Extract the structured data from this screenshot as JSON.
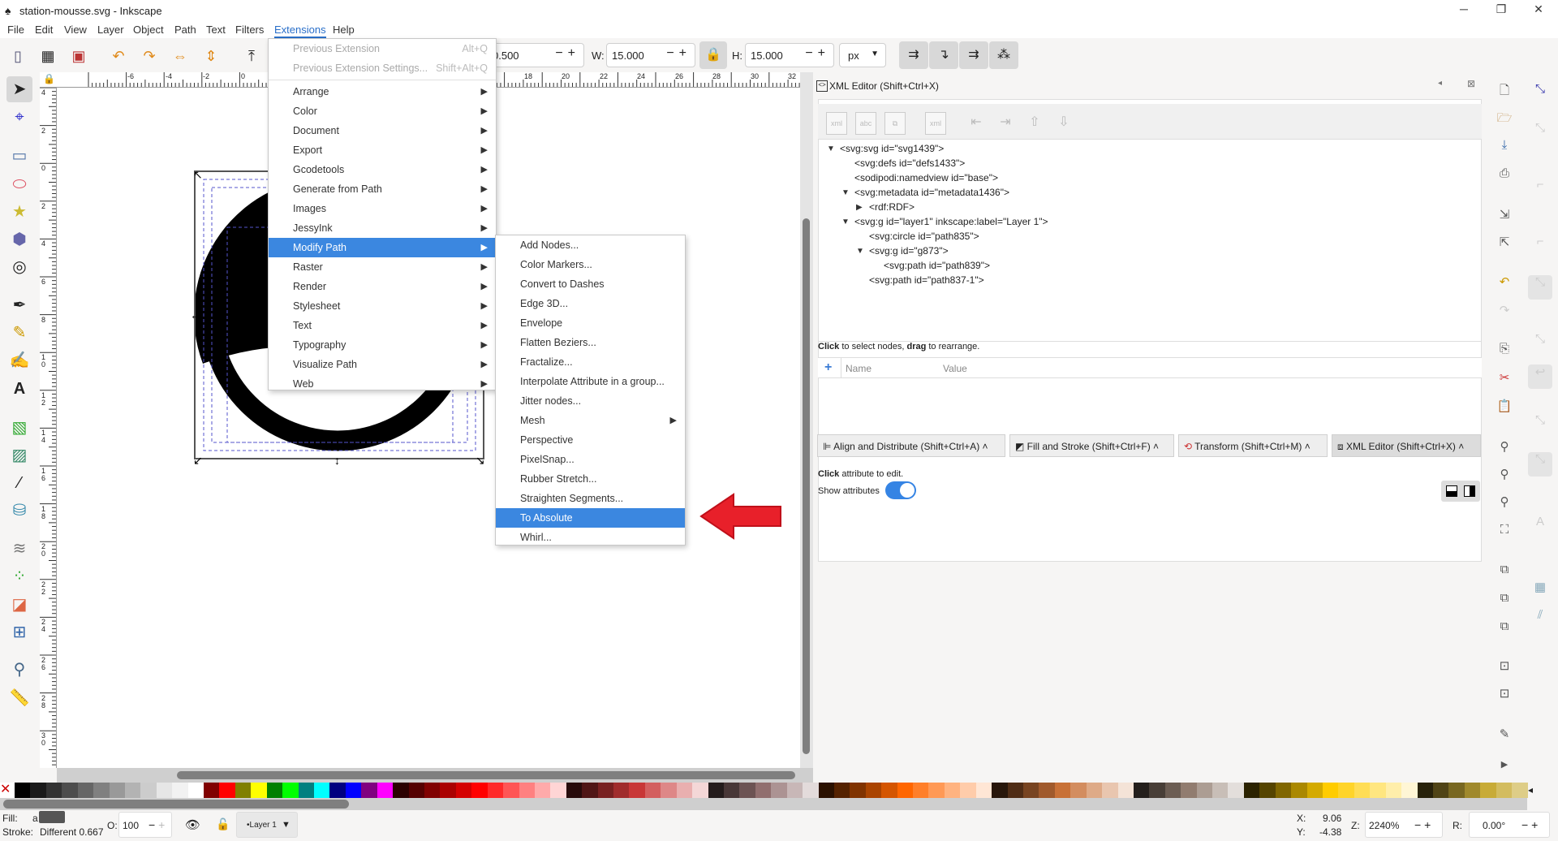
{
  "window": {
    "title": "station-mousse.svg - Inkscape",
    "minimize": "─",
    "maximize": "❐",
    "close": "✕"
  },
  "menubar": [
    "File",
    "Edit",
    "View",
    "Layer",
    "Object",
    "Path",
    "Text",
    "Filters",
    "Extensions",
    "Help"
  ],
  "toolbar": {
    "x_value": "0.500",
    "w_label": "W:",
    "w_value": "15.000",
    "h_label": "H:",
    "h_value": "15.000",
    "unit": "px",
    "minus": "−",
    "plus": "+"
  },
  "ruler": {
    "h_ticks": [
      "-6",
      "-4",
      "-2",
      "0",
      "2",
      "18",
      "20",
      "22",
      "24",
      "26",
      "28",
      "30",
      "32"
    ],
    "v_ticks": [
      "4",
      "2",
      "0",
      "2",
      "4",
      "6",
      "8",
      "10",
      "12",
      "14",
      "16",
      "18",
      "20",
      "22",
      "24",
      "26",
      "28",
      "30"
    ]
  },
  "extensions_menu": {
    "previous": {
      "label": "Previous Extension",
      "shortcut": "Alt+Q"
    },
    "previous_settings": {
      "label": "Previous Extension Settings...",
      "shortcut": "Shift+Alt+Q"
    },
    "items": [
      "Arrange",
      "Color",
      "Document",
      "Export",
      "Gcodetools",
      "Generate from Path",
      "Images",
      "JessyInk",
      "Modify Path",
      "Raster",
      "Render",
      "Stylesheet",
      "Text",
      "Typography",
      "Visualize Path",
      "Web"
    ],
    "highlighted": "Modify Path"
  },
  "modify_path_menu": {
    "items": [
      "Add Nodes...",
      "Color Markers...",
      "Convert to Dashes",
      "Edge 3D...",
      "Envelope",
      "Flatten Beziers...",
      "Fractalize...",
      "Interpolate Attribute in a group...",
      "Jitter nodes...",
      "Mesh",
      "Perspective",
      "PixelSnap...",
      "Rubber Stretch...",
      "Straighten Segments...",
      "To Absolute",
      "Whirl..."
    ],
    "highlighted": "To Absolute",
    "submenu_item": "Mesh"
  },
  "annotation": {
    "arrow_color": "#e8202a"
  },
  "xml_editor": {
    "title": "XML Editor (Shift+Ctrl+X)",
    "nodes": [
      {
        "text": "<svg:svg id=\"svg1439\">",
        "level": 0,
        "expander": "expanded"
      },
      {
        "text": "<svg:defs id=\"defs1433\">",
        "level": 1,
        "expander": "none"
      },
      {
        "text": "<sodipodi:namedview id=\"base\">",
        "level": 1,
        "expander": "none"
      },
      {
        "text": "<svg:metadata id=\"metadata1436\">",
        "level": 1,
        "expander": "expanded"
      },
      {
        "text": "<rdf:RDF>",
        "level": 2,
        "expander": "collapsed"
      },
      {
        "text": "<svg:g id=\"layer1\" inkscape:label=\"Layer 1\">",
        "level": 1,
        "expander": "expanded"
      },
      {
        "text": "<svg:circle id=\"path835\">",
        "level": 2,
        "expander": "none"
      },
      {
        "text": "<svg:g id=\"g873\">",
        "level": 2,
        "expander": "expanded"
      },
      {
        "text": "<svg:path id=\"path839\">",
        "level": 3,
        "expander": "none"
      },
      {
        "text": "<svg:path id=\"path837-1\">",
        "level": 2,
        "expander": "none"
      }
    ],
    "hint_bold1": "Click",
    "hint_rest1": " to select nodes, ",
    "hint_bold2": "drag",
    "hint_rest2": " to rearrange.",
    "col_name": "Name",
    "col_value": "Value",
    "attr_hint_bold": "Click",
    "attr_hint_rest": " attribute to edit.",
    "show_attributes": "Show attributes",
    "show_attributes_on": true
  },
  "dock_tabs": [
    "Align and Distribute (Shift+Ctrl+A)",
    "Fill and Stroke (Shift+Ctrl+F)",
    "Transform (Shift+Ctrl+M)",
    "XML Editor (Shift+Ctrl+X)"
  ],
  "status": {
    "fill_label": "Fill:",
    "fill_value": "a",
    "stroke_label": "Stroke:",
    "stroke_value": "Different 0.667",
    "opacity_label": "O:",
    "opacity_value": "100",
    "layer": "•Layer 1",
    "x_label": "X:",
    "x_value": "9.06",
    "y_label": "Y:",
    "y_value": "-4.38",
    "zoom_label": "Z:",
    "zoom_value": "2240%",
    "rot_label": "R:",
    "rot_value": "0.00°"
  },
  "palette": [
    "#000000",
    "#1a1a1a",
    "#333333",
    "#4d4d4d",
    "#666666",
    "#808080",
    "#999999",
    "#b3b3b3",
    "#cccccc",
    "#e6e6e6",
    "#f2f2f2",
    "#ffffff",
    "#800000",
    "#ff0000",
    "#808000",
    "#ffff00",
    "#008000",
    "#00ff00",
    "#008080",
    "#00ffff",
    "#000080",
    "#0000ff",
    "#800080",
    "#ff00ff",
    "#2b0000",
    "#550000",
    "#800000",
    "#aa0000",
    "#d40000",
    "#ff0000",
    "#ff2a2a",
    "#ff5555",
    "#ff8080",
    "#ffaaaa",
    "#ffd5d5",
    "#280b0b",
    "#501616",
    "#782121",
    "#a02c2c",
    "#c83737",
    "#d35f5f",
    "#de8787",
    "#e9afaf",
    "#f4d7d7",
    "#241c1c",
    "#483737",
    "#6c5353",
    "#916f6f",
    "#ac9393",
    "#c8b7b7",
    "#e3dbdb",
    "#2b1100",
    "#552200",
    "#803300",
    "#aa4400",
    "#d45500",
    "#ff6600",
    "#ff7f2a",
    "#ff9955",
    "#ffb380",
    "#ffccaa",
    "#ffe6d5",
    "#28170b",
    "#502d16",
    "#784421",
    "#a05a2c",
    "#c87137",
    "#d38d5f",
    "#deaa87",
    "#e9c6af",
    "#f4e3d7",
    "#241f1c",
    "#483e37",
    "#6c5d53",
    "#917c6f",
    "#ac9d93",
    "#c8beb7",
    "#e3dedb",
    "#2b2200",
    "#554400",
    "#806600",
    "#aa8800",
    "#d4aa00",
    "#ffcc00",
    "#ffd42a",
    "#ffdd55",
    "#ffe680",
    "#ffeeaa",
    "#fff6d5",
    "#28220b",
    "#504416",
    "#786721",
    "#a0892c",
    "#c8ab37",
    "#d3bc5f",
    "#decd87"
  ]
}
